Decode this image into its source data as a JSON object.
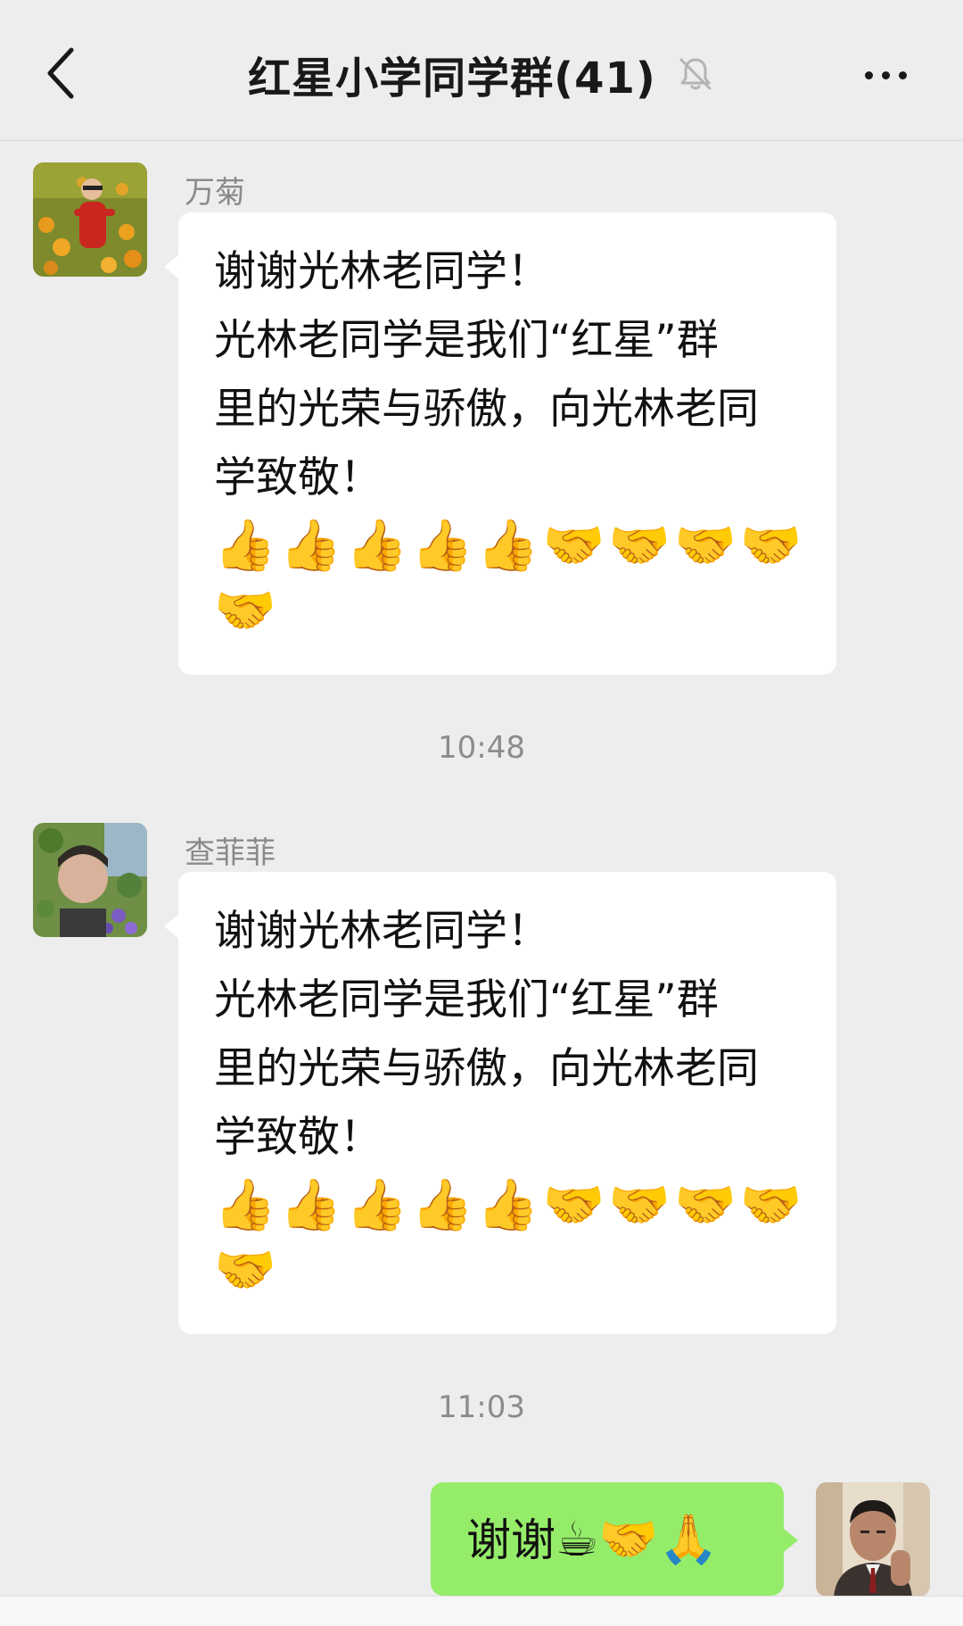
{
  "header": {
    "title": "红星小学同学群(41)",
    "back_icon": "chevron-left-icon",
    "mute_icon": "bell-off-icon",
    "more_icon": "more-dots-icon"
  },
  "messages": [
    {
      "sender": "万菊",
      "lines": [
        "谢谢光林老同学！",
        "光林老同学是我们“红星”群",
        "里的光荣与骄傲，向光林老同",
        "学致敬！"
      ],
      "emoji_line1": "👍👍👍👍👍🤝🤝🤝🤝",
      "emoji_line2": "🤝"
    },
    {
      "sender": "查菲菲",
      "lines": [
        "谢谢光林老同学！",
        "光林老同学是我们“红星”群",
        "里的光荣与骄傲，向光林老同",
        "学致敬！"
      ],
      "emoji_line1": "👍👍👍👍👍🤝🤝🤝🤝",
      "emoji_line2": "🤝"
    }
  ],
  "timestamps": [
    "10:48",
    "11:03"
  ],
  "self_message": {
    "text": "谢谢",
    "emojis": "☕🤝🙏"
  },
  "colors": {
    "background": "#EDEDED",
    "bubble_other": "#FFFFFF",
    "bubble_self": "#95EC69",
    "timestamp": "#8C8C8C"
  }
}
